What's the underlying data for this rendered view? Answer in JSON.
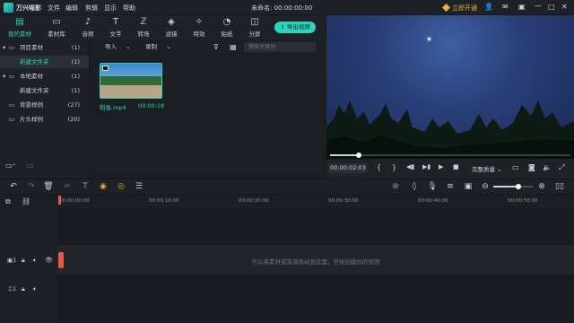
{
  "app": {
    "name": "万兴喵影",
    "project_title": "未命名: 00:00:00:00"
  },
  "menu": [
    "文件",
    "编辑",
    "剪辑",
    "显示",
    "帮助"
  ],
  "titlebar_right": {
    "upgrade_label": "立即开通"
  },
  "toolbar": {
    "tools": [
      {
        "label": "我的素材",
        "icon": "folder-media-icon",
        "active": true
      },
      {
        "label": "素材库",
        "icon": "folder-icon"
      },
      {
        "label": "音频",
        "icon": "music-note-icon"
      },
      {
        "label": "文字",
        "icon": "text-icon"
      },
      {
        "label": "转场",
        "icon": "transition-icon"
      },
      {
        "label": "滤镜",
        "icon": "filter-icon"
      },
      {
        "label": "特效",
        "icon": "effects-icon"
      },
      {
        "label": "贴纸",
        "icon": "sticker-icon"
      },
      {
        "label": "分屏",
        "icon": "split-screen-icon"
      }
    ],
    "export_label": "导出视频"
  },
  "left_panel": {
    "items": [
      {
        "label": "项目素材",
        "count": "(1)"
      },
      {
        "label": "新建文件夹",
        "count": "(1)"
      },
      {
        "label": "本地素材",
        "count": "(1)"
      },
      {
        "label": "新建文件夹",
        "count": "(1)"
      },
      {
        "label": "背景样例",
        "count": "(27)"
      },
      {
        "label": "片头样例",
        "count": "(20)"
      }
    ]
  },
  "media": {
    "import_label": "导入",
    "record_label": "录制",
    "search_placeholder": "搜索关键词",
    "clip": {
      "name": "稻香.mp4",
      "duration": "00:00:18"
    }
  },
  "player": {
    "time": "00:00:02:03",
    "quality": "完整质量",
    "progress": 0.12
  },
  "timeline": {
    "ruler": [
      "00:00:00:00",
      "00:00:10:00",
      "00:00:20:00",
      "00:00:30:00",
      "00:00:40:00",
      "00:00:50:00"
    ],
    "hint": "可以将素材或资源拖动到这里，开始创建你的视频",
    "video_track": "1",
    "audio_track": "1"
  },
  "colors": {
    "accent": "#2fd3b8",
    "background": "#1b1f24"
  }
}
